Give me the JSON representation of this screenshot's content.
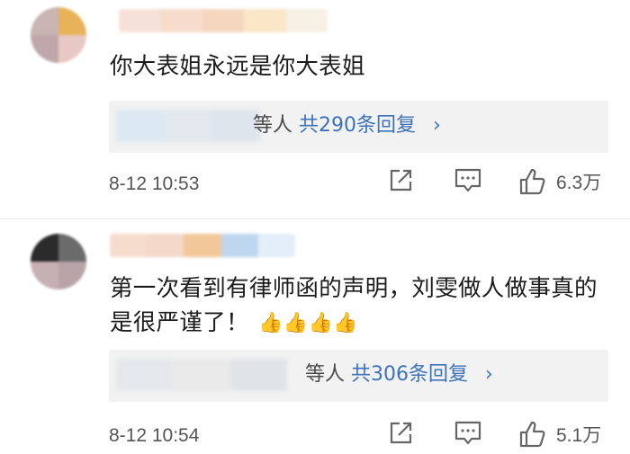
{
  "comments": [
    {
      "text": "你大表姐永远是你大表姐",
      "avatar_colors": [
        "#c9b3b3",
        "#e6b35a",
        "#c0a8aa",
        "#e8c8c4"
      ],
      "name_colors": [
        "#f6e1d8",
        "#f8dccb",
        "#f5d7c0",
        "#fae7c8",
        "#f7f0e4"
      ],
      "reply_blur_colors": [
        "#dce8f2",
        "#e2e8ee",
        "#dfe5ec"
      ],
      "reply_partial": "等人",
      "reply_count_label": "共290条回复",
      "time": "8-12 10:53",
      "likes": "6.3万"
    },
    {
      "text": "第一次看到有律师函的声明，刘雯做人做事真的是很严谨了！",
      "thumbs": "👍👍👍👍",
      "avatar_colors": [
        "#2b2b2b",
        "#6b6b6b",
        "#c7b0b3",
        "#b9a4a8"
      ],
      "name_colors": [
        "#f6dccd",
        "#f4d8c8",
        "#f2c89a",
        "#bed7ef",
        "#e4eef8"
      ],
      "reply_blur_colors": [
        "#e4e8ec",
        "#eaeaea",
        "#e0e4e8"
      ],
      "reply_partial": "等人",
      "reply_count_label": "共306条回复",
      "time": "8-12 10:54",
      "likes": "5.1万"
    }
  ],
  "colors": {
    "link": "#3d73b8",
    "meta": "#555555",
    "reply_bg": "#f2f2f2"
  },
  "icons": [
    "share-icon",
    "comment-icon",
    "like-icon",
    "chevron-right-icon",
    "thumbs-up-emoji"
  ]
}
